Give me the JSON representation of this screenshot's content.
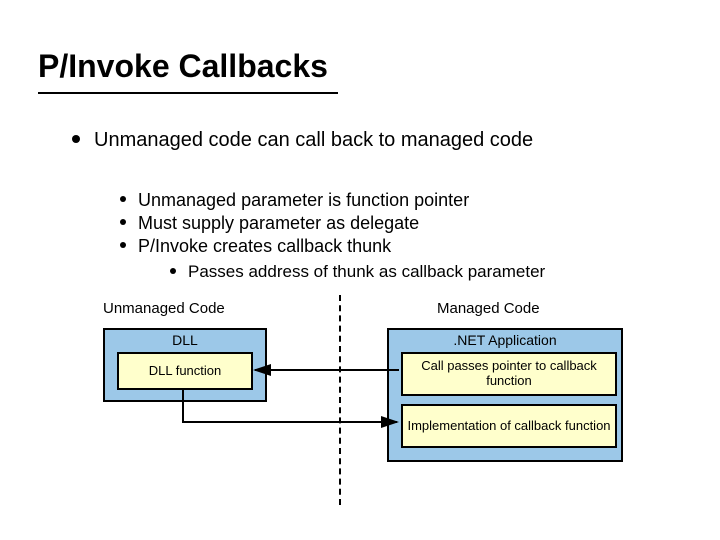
{
  "title": "P/Invoke Callbacks",
  "main_bullet": "Unmanaged code can call back to managed code",
  "sub_bullets": [
    "Unmanaged parameter is function pointer",
    "Must supply parameter as delegate",
    "P/Invoke creates callback thunk"
  ],
  "sub_sub_bullet": "Passes address of thunk as callback parameter",
  "diagram": {
    "unmanaged_label": "Unmanaged Code",
    "managed_label": "Managed Code",
    "dll_box_title": "DLL",
    "dll_function": "DLL function",
    "net_box_title": ".NET Application",
    "call_box": "Call passes pointer to callback function",
    "impl_box": "Implementation of callback function"
  }
}
